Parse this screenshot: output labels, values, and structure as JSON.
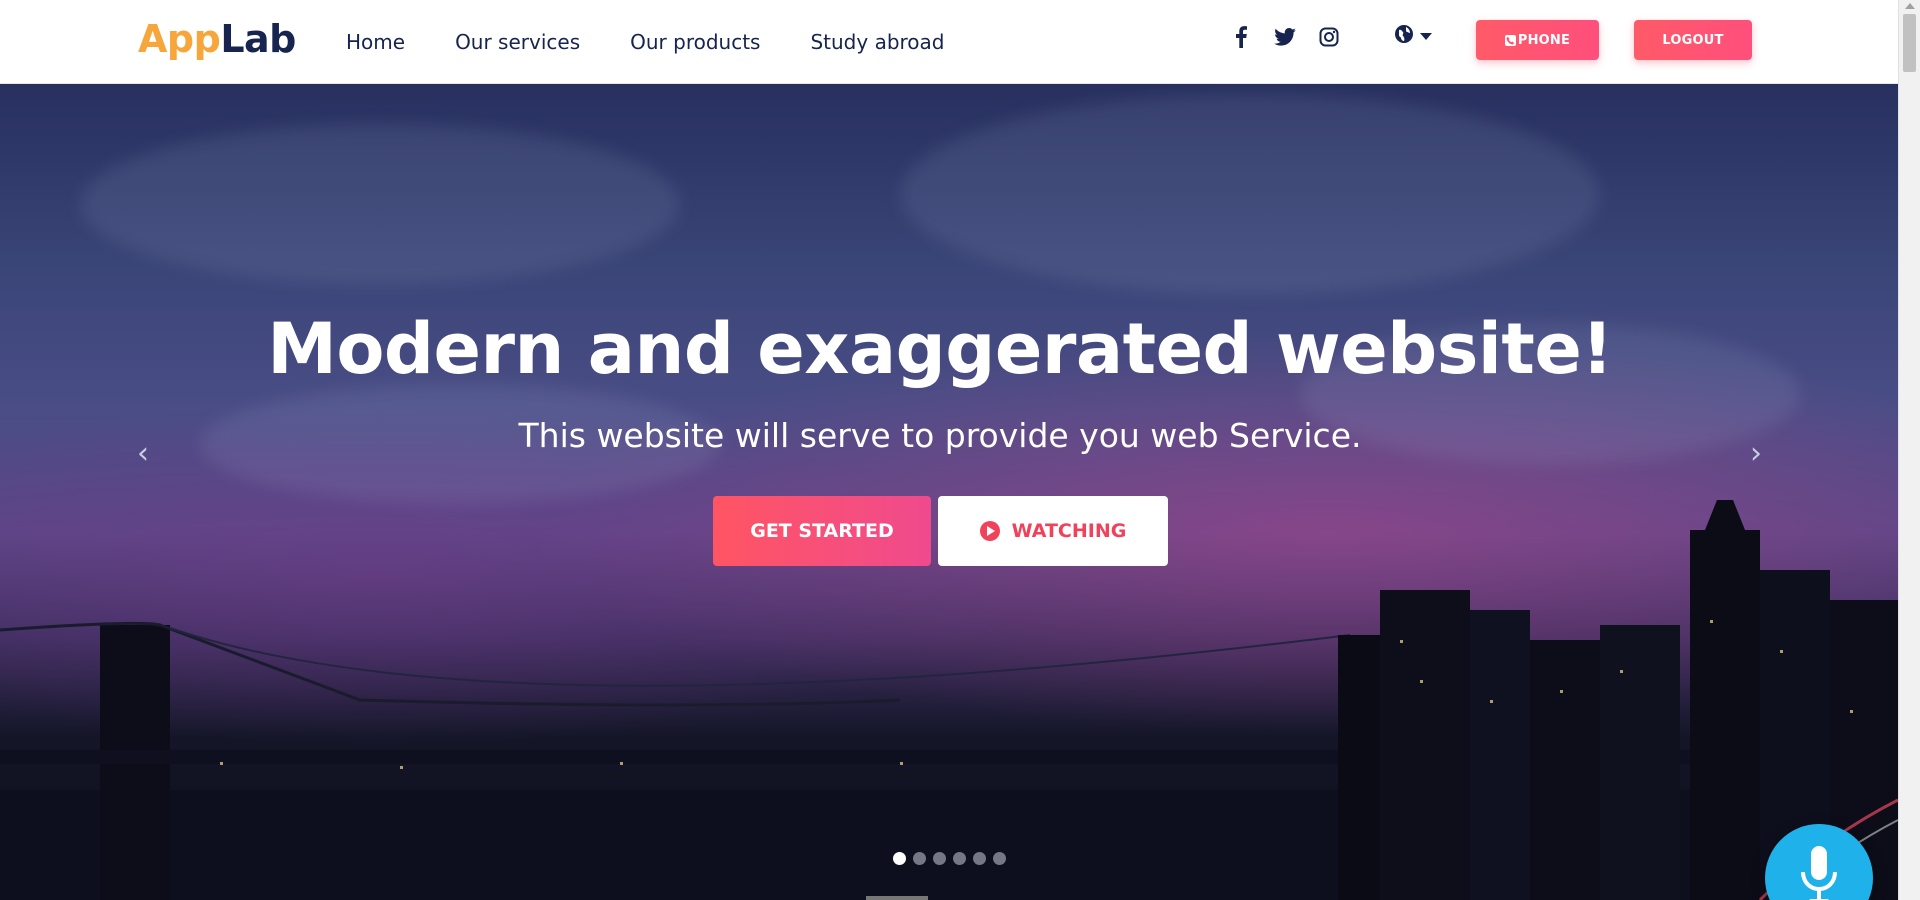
{
  "header": {
    "logo_part1": "App",
    "logo_part2": "Lab",
    "nav": [
      {
        "label": "Home"
      },
      {
        "label": "Our services"
      },
      {
        "label": "Our products"
      },
      {
        "label": "Study abroad"
      }
    ],
    "social": [
      "facebook-icon",
      "twitter-icon",
      "instagram-icon"
    ],
    "language_icon": "globe-icon",
    "phone_label": "PHONE",
    "logout_label": "LOGOUT"
  },
  "hero": {
    "title": "Modern and exaggerated website!",
    "subtitle": "This website will serve to provide you web Service.",
    "get_started_label": "GET STARTED",
    "watching_label": "WATCHING",
    "prev_arrow": "‹",
    "next_arrow": "›",
    "slides_total": 6,
    "active_slide": 1
  },
  "colors": {
    "brand_orange": "#f7a63b",
    "brand_navy": "#16244f",
    "accent_pink": "#ff5a68",
    "mic_blue": "#1fb2ea"
  }
}
